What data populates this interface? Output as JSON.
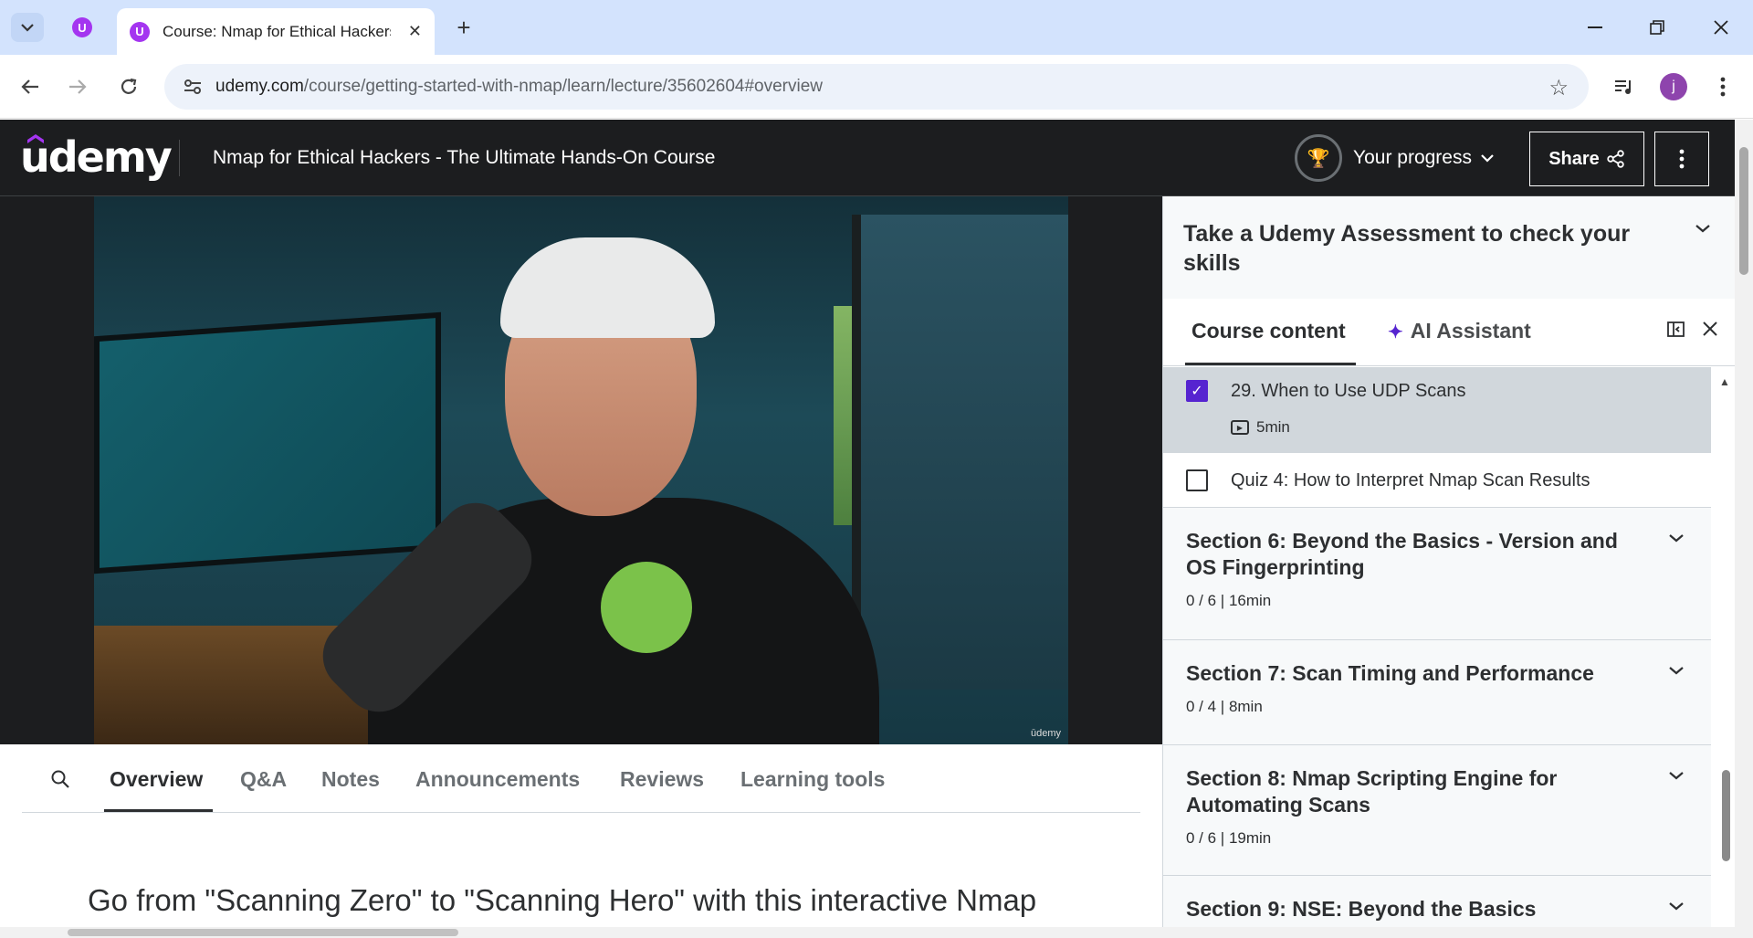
{
  "browser": {
    "active_tab_title": "Course: Nmap for Ethical Hackers - The Ultimate Hands-On Course",
    "url_host": "udemy.com",
    "url_path": "/course/getting-started-with-nmap/learn/lecture/35602604#overview",
    "profile_initial": "j",
    "favicon_letter": "U"
  },
  "header": {
    "logo": "udemy",
    "course_title": "Nmap for Ethical Hackers - The Ultimate Hands-On Course",
    "progress_label": "Your progress",
    "share_label": "Share"
  },
  "video": {
    "watermark": "ūdemy"
  },
  "lecture_tabs": [
    "Overview",
    "Q&A",
    "Notes",
    "Announcements",
    "Reviews",
    "Learning tools"
  ],
  "overview_text": "Go from \"Scanning Zero\" to \"Scanning Hero\" with this interactive Nmap",
  "sidebar": {
    "assessment": "Take a Udemy Assessment to check your skills",
    "tab_course_content": "Course content",
    "tab_ai_assistant": "AI Assistant",
    "items": [
      {
        "title": "29. When to Use UDP Scans",
        "duration": "5min",
        "checked": true
      },
      {
        "title": "Quiz 4: How to Interpret Nmap Scan Results",
        "checked": false
      }
    ],
    "sections": [
      {
        "title": "Section 6: Beyond the Basics - Version and OS Fingerprinting",
        "meta": "0 / 6 | 16min"
      },
      {
        "title": "Section 7: Scan Timing and Performance",
        "meta": "0 / 4 | 8min"
      },
      {
        "title": "Section 8: Nmap Scripting Engine for Automating Scans",
        "meta": "0 / 6 | 19min"
      },
      {
        "title": "Section 9: NSE: Beyond the Basics",
        "meta": ""
      }
    ]
  }
}
